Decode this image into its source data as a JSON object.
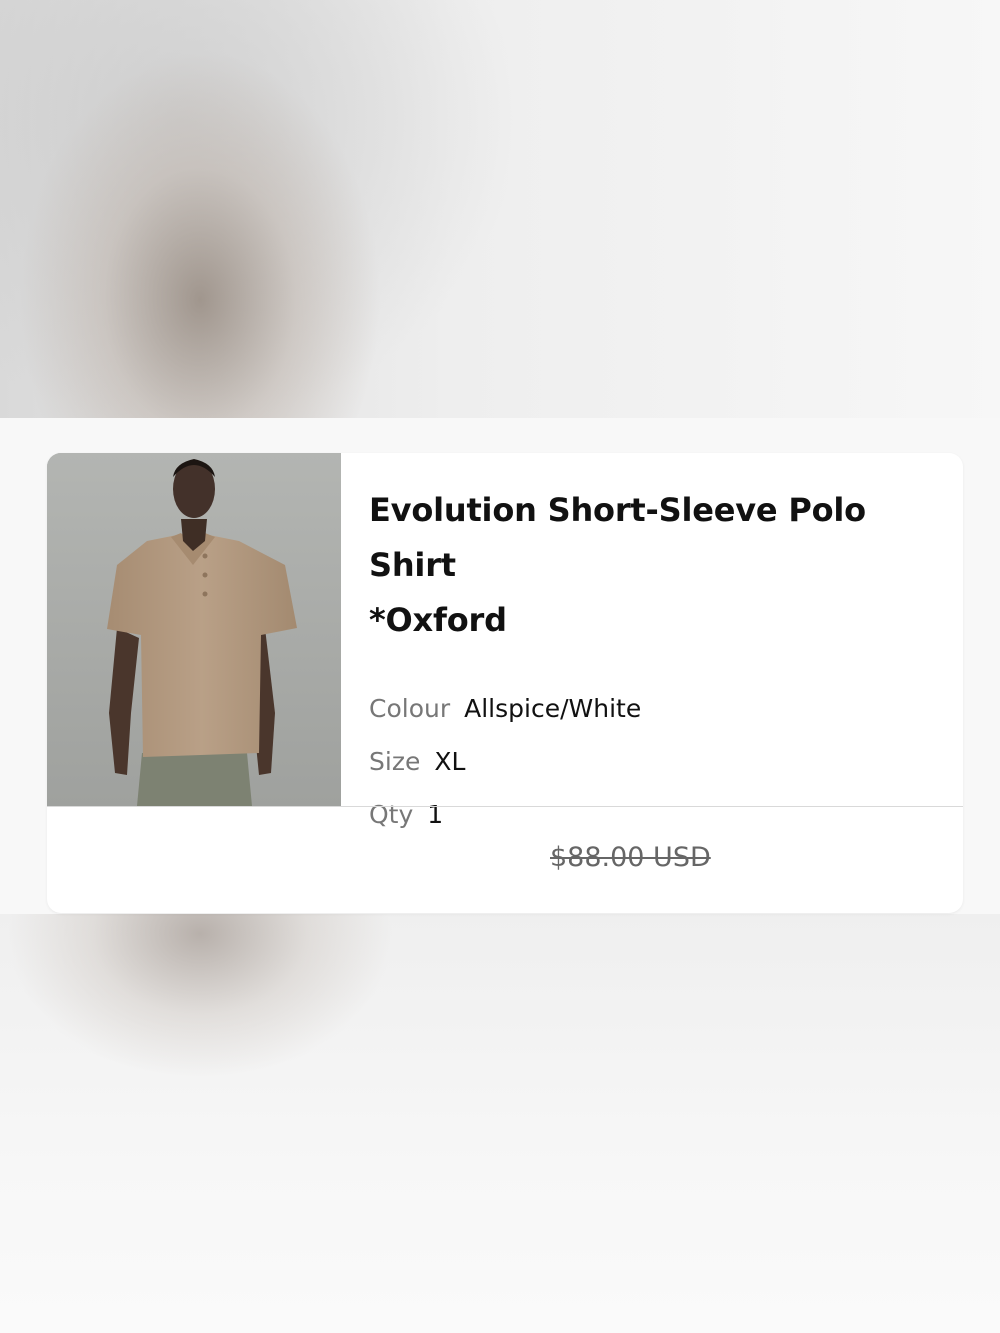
{
  "product": {
    "title_line1": "Evolution Short-Sleeve Polo Shirt",
    "title_line2": "*Oxford",
    "colour_label": "Colour",
    "colour_value": "Allspice/White",
    "size_label": "Size",
    "size_value": "XL",
    "qty_label": "Qty",
    "qty_value": "1",
    "price": "$88.00 USD",
    "image_icon": "product-photo-polo-shirt"
  },
  "colors": {
    "card_background": "#ffffff",
    "title_text": "#111111",
    "label_text": "#777777",
    "price_text": "#666666",
    "shirt": "#b39a80",
    "photo_background": "#a9aba8"
  }
}
